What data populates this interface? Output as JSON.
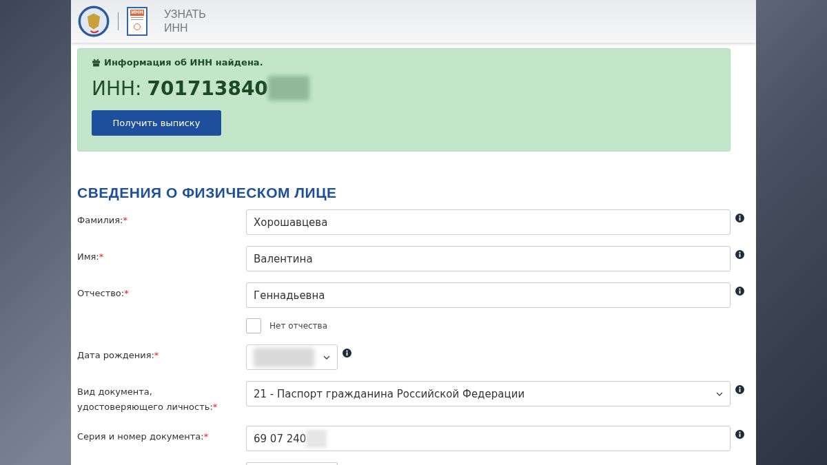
{
  "header": {
    "badge_text": "ИНН",
    "title_lines": [
      "УЗНАТЬ",
      "ИНН"
    ]
  },
  "alert": {
    "message": "Информация об ИНН найдена.",
    "inn_label": "ИНН:",
    "inn_value": "701713840",
    "inn_redacted": true,
    "button": "Получить выписку"
  },
  "section_title": "СВЕДЕНИЯ О ФИЗИЧЕСКОМ ЛИЦЕ",
  "fields": [
    {
      "kind": "text",
      "label": "Фамилия:",
      "mark": "*",
      "value": "Хорошавцева",
      "info": true
    },
    {
      "kind": "text",
      "label": "Имя:",
      "mark": "*",
      "value": "Валентина",
      "info": true
    },
    {
      "kind": "text",
      "label": "Отчество:",
      "mark": "*",
      "value": "Геннадьевна",
      "info": true
    },
    {
      "kind": "checkbox",
      "label": "Нет отчества",
      "checked": false
    },
    {
      "kind": "date",
      "label": "Дата рождения:",
      "mark": "*",
      "redacted": true,
      "info": true
    },
    {
      "kind": "select",
      "label": "Вид документа, удостоверяющего личность:",
      "mark": "*",
      "value": "21 - Паспорт гражданина Российской Федерации",
      "info": true
    },
    {
      "kind": "text",
      "label": "Серия и номер документа:",
      "mark": "*",
      "value": "69 07 240",
      "redacted": true,
      "info": true
    },
    {
      "kind": "partial"
    }
  ]
}
